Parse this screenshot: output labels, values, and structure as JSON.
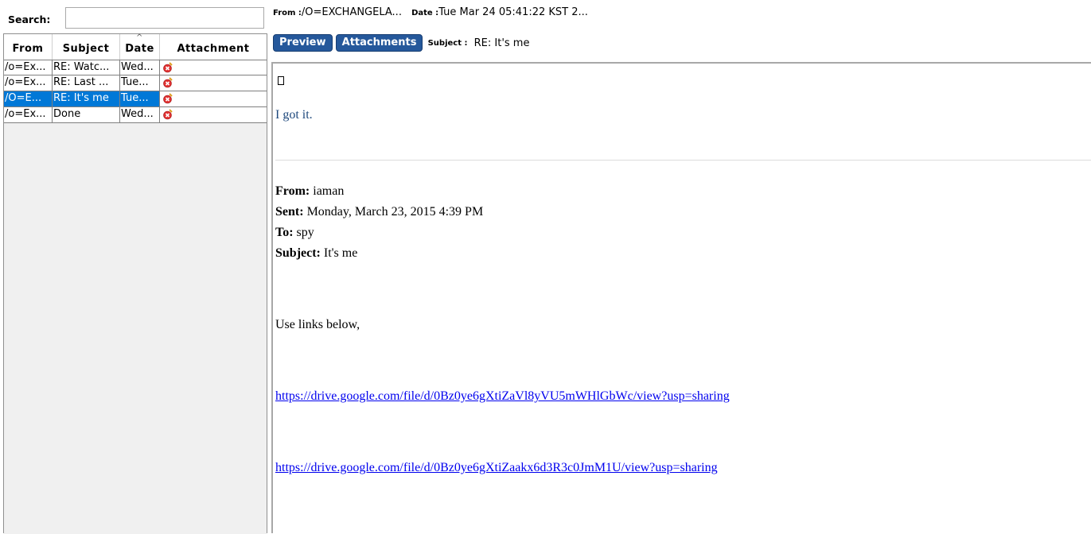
{
  "search": {
    "label": "Search:",
    "value": "",
    "placeholder": ""
  },
  "grid": {
    "columns": [
      "From",
      "Subject",
      "Date",
      "Attachment"
    ],
    "sort_indicator": "^",
    "rows": [
      {
        "from": "/o=Ex...",
        "subject": "RE: Watc...",
        "date": "Wed...",
        "attachment_icon": "attachment-error-icon",
        "selected": false
      },
      {
        "from": "/o=Ex...",
        "subject": "RE: Last ...",
        "date": "Tue...",
        "attachment_icon": "attachment-error-icon",
        "selected": false
      },
      {
        "from": "/O=E...",
        "subject": "RE: It's me",
        "date": "Tue...",
        "attachment_icon": "attachment-error-icon",
        "selected": true
      },
      {
        "from": "/o=Ex...",
        "subject": "Done",
        "date": "Wed...",
        "attachment_icon": "attachment-error-icon",
        "selected": false
      }
    ]
  },
  "header": {
    "from_label": "From :",
    "from_value": "/O=EXCHANGELA...",
    "date_label": "Date :",
    "date_value": "Tue Mar 24 05:41:22 KST 2...",
    "subject_label": "Subject :",
    "subject_value": "RE: It's me"
  },
  "tabs": {
    "preview": "Preview",
    "attachments": "Attachments"
  },
  "message": {
    "reply": "I got it.",
    "from_label": "From:",
    "from_value": "iaman",
    "sent_label": "Sent:",
    "sent_value": "Monday, March 23, 2015 4:39 PM",
    "to_label": "To:",
    "to_value": "spy",
    "subject_label": "Subject:",
    "subject_value": "It's me",
    "body": "Use links below,",
    "links": [
      "https://drive.google.com/file/d/0Bz0ye6gXtiZaVl8yVU5mWHlGbWc/view?usp=sharing",
      "https://drive.google.com/file/d/0Bz0ye6gXtiZaakx6d3R3c0JmM1U/view?usp=sharing"
    ]
  },
  "colors": {
    "tab_blue": "#25589b",
    "selection_blue": "#0078d7",
    "reply_text": "#1f497d",
    "link": "#0000ee"
  }
}
